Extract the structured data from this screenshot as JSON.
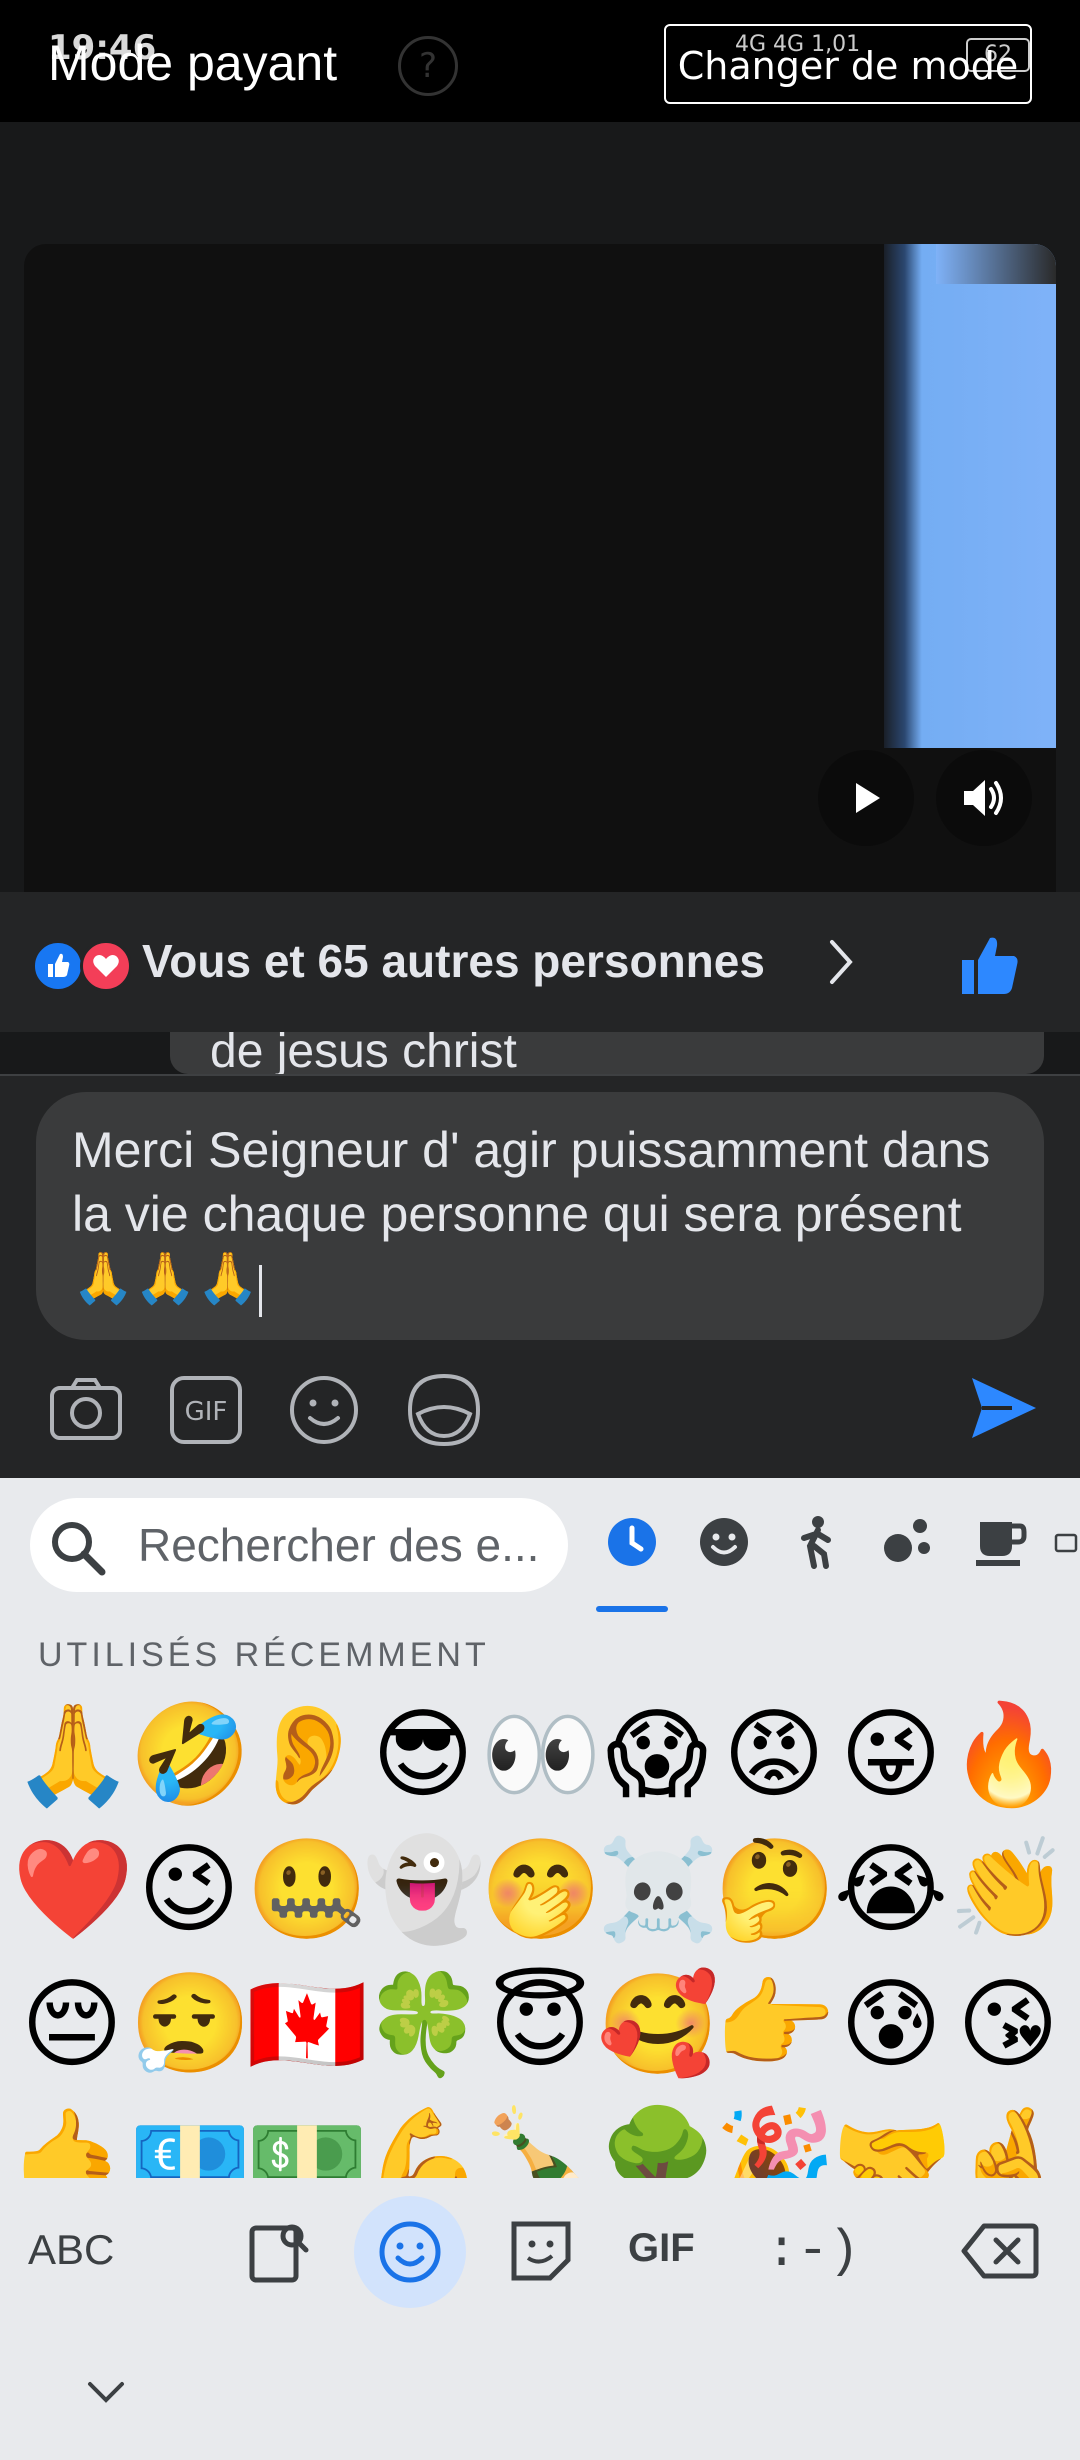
{
  "status_bar": {
    "time": "19:46",
    "network": "4G  4G",
    "speed": "1,01",
    "battery": "62"
  },
  "header": {
    "mode_title": "Mode payant",
    "help": "?",
    "change_mode_button": "Changer de mode"
  },
  "post": {
    "reactions_text": "Vous et 65 autres personnes",
    "comment_snippet": "de jesus christ"
  },
  "composer": {
    "text": "Merci Seigneur d' agir puissamment dans la vie chaque personne qui sera présent 🙏🙏🙏"
  },
  "keyboard": {
    "search_placeholder": "Rechercher des e...",
    "section_header": "UTILISÉS RÉCEMMENT",
    "abc_label": "ABC",
    "gif_label": "GIF",
    "emoticon_label": ":-)",
    "recent_emojis": [
      [
        "🙏",
        "🤣",
        "👂",
        "😎",
        "👀",
        "😱",
        "😡",
        "😜",
        "🔥"
      ],
      [
        "❤️",
        "😉",
        "🤐",
        "👻",
        "🤭",
        "☠️",
        "🤔",
        "😭",
        "👏"
      ],
      [
        "😔",
        "😮‍💨",
        "🇨🇦",
        "🍀",
        "😇",
        "🥰",
        "👉",
        "😰",
        "😘"
      ],
      [
        "🤙",
        "💶",
        "💵",
        "💪",
        "🍾",
        "🌳",
        "🎉",
        "🤝",
        "🤞"
      ]
    ]
  },
  "colors": {
    "accent": "#1877f2",
    "love": "#f33e58",
    "keyboard_accent": "#1a73e8"
  }
}
